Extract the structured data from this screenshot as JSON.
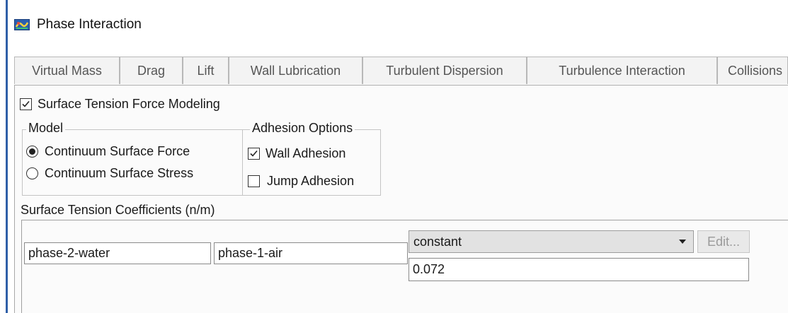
{
  "window": {
    "title": "Phase Interaction",
    "icon": "ansys-fluent-icon"
  },
  "tabs": [
    {
      "label": "Virtual Mass"
    },
    {
      "label": "Drag"
    },
    {
      "label": "Lift"
    },
    {
      "label": "Wall Lubrication"
    },
    {
      "label": "Turbulent Dispersion"
    },
    {
      "label": "Turbulence Interaction"
    },
    {
      "label": "Collisions"
    }
  ],
  "surface_tension": {
    "enable_label": "Surface Tension Force Modeling",
    "enabled": true
  },
  "model": {
    "group_label": "Model",
    "options": [
      {
        "label": "Continuum Surface Force",
        "selected": true
      },
      {
        "label": "Continuum Surface Stress",
        "selected": false
      }
    ]
  },
  "adhesion": {
    "group_label": "Adhesion Options",
    "wall": {
      "label": "Wall Adhesion",
      "checked": true
    },
    "jump": {
      "label": "Jump Adhesion",
      "checked": false
    }
  },
  "coefficients": {
    "section_label": "Surface Tension Coefficients (n/m)",
    "phase_a": "phase-2-water",
    "phase_b": "phase-1-air",
    "method": "constant",
    "value": "0.072",
    "edit_label": "Edit..."
  },
  "colors": {
    "accent_edge": "#2f5fa8",
    "panel_bg": "#fbfbfb",
    "tab_bg": "#f3f3f3",
    "dropdown_bg": "#e2e2e2"
  }
}
